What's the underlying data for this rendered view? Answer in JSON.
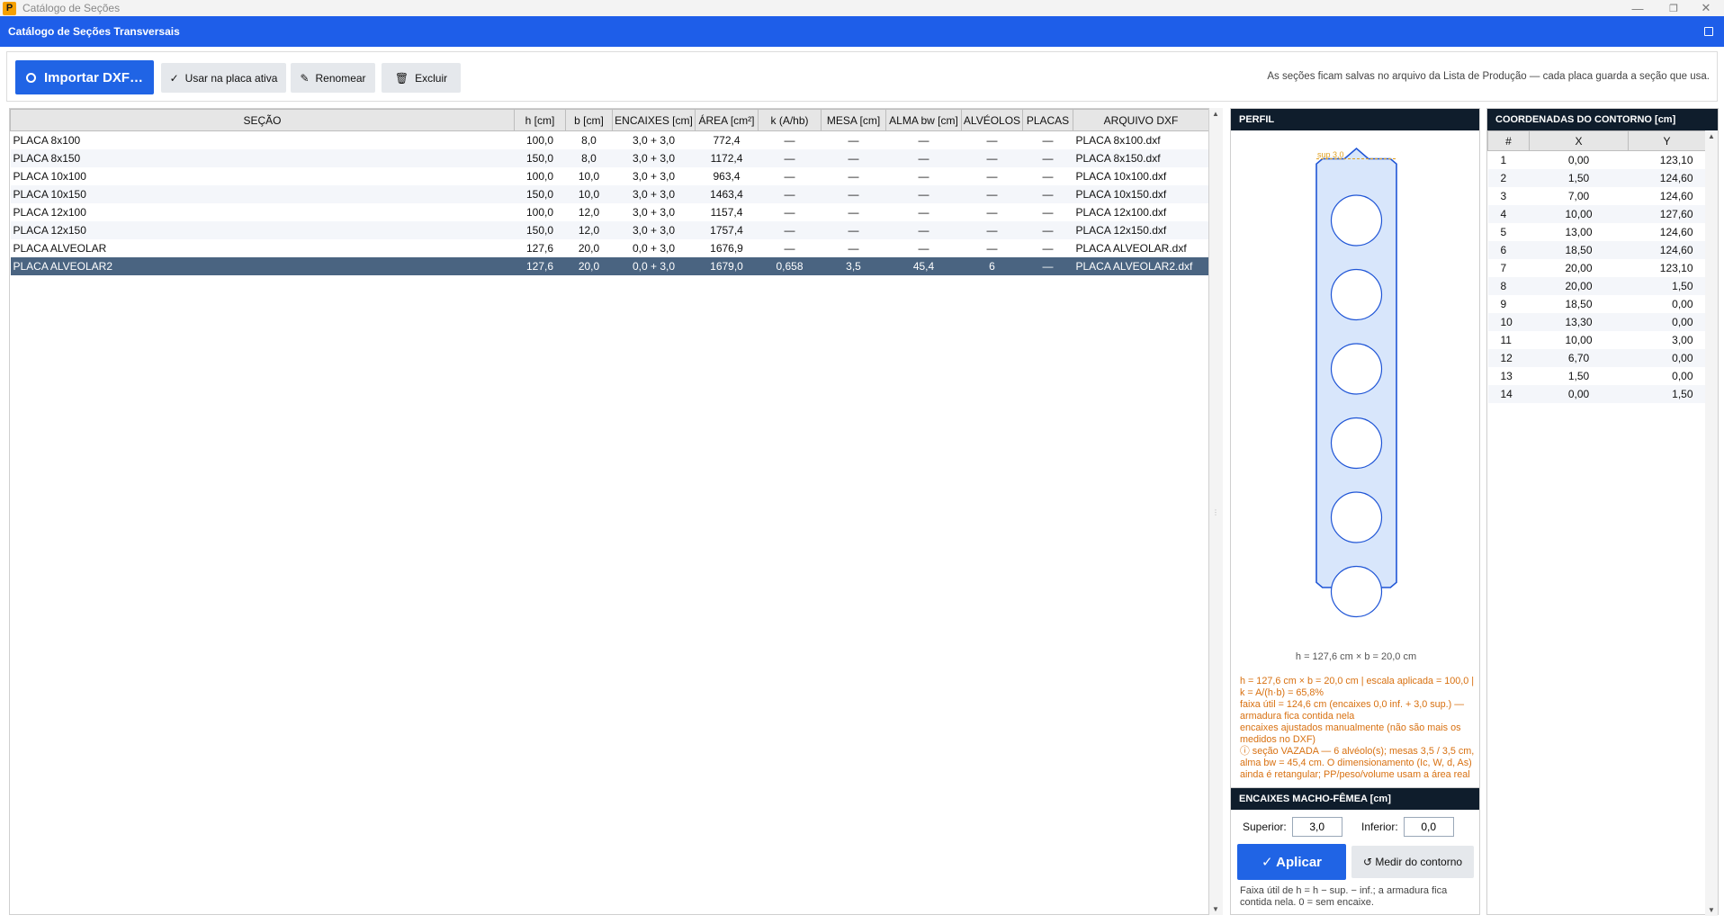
{
  "window": {
    "title": "Catálogo de Seções",
    "app_icon": "P"
  },
  "header": {
    "title": "Catálogo de Seções Transversais"
  },
  "toolbar": {
    "import_label": "Importar DXF…",
    "use_label": "Usar na placa ativa",
    "rename_label": "Renomear",
    "delete_label": "Excluir",
    "hint": "As seções ficam salvas no arquivo da Lista de Produção — cada placa guarda a seção que usa."
  },
  "table": {
    "columns": [
      "SEÇÃO",
      "h [cm]",
      "b [cm]",
      "ENCAIXES [cm]",
      "ÁREA [cm²]",
      "k (A/hb)",
      "MESA [cm]",
      "ALMA bw [cm]",
      "ALVÉOLOS",
      "PLACAS",
      "ARQUIVO DXF"
    ],
    "rows": [
      [
        "PLACA 8x100",
        "100,0",
        "8,0",
        "3,0 + 3,0",
        "772,4",
        "—",
        "—",
        "—",
        "—",
        "—",
        "PLACA 8x100.dxf"
      ],
      [
        "PLACA 8x150",
        "150,0",
        "8,0",
        "3,0 + 3,0",
        "1172,4",
        "—",
        "—",
        "—",
        "—",
        "—",
        "PLACA 8x150.dxf"
      ],
      [
        "PLACA 10x100",
        "100,0",
        "10,0",
        "3,0 + 3,0",
        "963,4",
        "—",
        "—",
        "—",
        "—",
        "—",
        "PLACA 10x100.dxf"
      ],
      [
        "PLACA 10x150",
        "150,0",
        "10,0",
        "3,0 + 3,0",
        "1463,4",
        "—",
        "—",
        "—",
        "—",
        "—",
        "PLACA 10x150.dxf"
      ],
      [
        "PLACA 12x100",
        "100,0",
        "12,0",
        "3,0 + 3,0",
        "1157,4",
        "—",
        "—",
        "—",
        "—",
        "—",
        "PLACA 12x100.dxf"
      ],
      [
        "PLACA 12x150",
        "150,0",
        "12,0",
        "3,0 + 3,0",
        "1757,4",
        "—",
        "—",
        "—",
        "—",
        "—",
        "PLACA 12x150.dxf"
      ],
      [
        "PLACA ALVEOLAR",
        "127,6",
        "20,0",
        "0,0 + 3,0",
        "1676,9",
        "—",
        "—",
        "—",
        "—",
        "—",
        "PLACA ALVEOLAR.dxf"
      ],
      [
        "PLACA ALVEOLAR2",
        "127,6",
        "20,0",
        "0,0 + 3,0",
        "1679,0",
        "0,658",
        "3,5",
        "45,4",
        "6",
        "—",
        "PLACA ALVEOLAR2.dxf"
      ]
    ],
    "selected_index": 7
  },
  "perfil": {
    "title": "PERFIL",
    "sup_label": "sup 3,0",
    "hole_count": 6,
    "dims": "h = 127,6 cm  ×  b = 20,0 cm",
    "notes": [
      "h = 127,6 cm  ×  b = 20,0 cm  |  escala aplicada = 100,0  |  k = A/(h·b) = 65,8%",
      "faixa útil = 124,6 cm (encaixes 0,0 inf. + 3,0 sup.) — armadura fica contida nela",
      "encaixes ajustados manualmente (não são mais os medidos no DXF)",
      "ⓘ seção VAZADA — 6 alvéolo(s); mesas 3,5 / 3,5 cm, alma bw = 45,4 cm. O dimensionamento (Ic, W, d, As) ainda é retangular; PP/peso/volume usam a área real"
    ],
    "colors": {
      "outline": "#1f55d6",
      "fill": "#d8e6fb",
      "label": "#e0a020"
    }
  },
  "encaixes": {
    "title": "ENCAIXES MACHO-FÊMEA  [cm]",
    "superior_label": "Superior:",
    "superior_value": "3,0",
    "inferior_label": "Inferior:",
    "inferior_value": "0,0",
    "apply_label": "✓ Aplicar",
    "measure_label": "↺ Medir do contorno",
    "footnote": "Faixa útil de h = h − sup. − inf.; a armadura fica contida nela. 0 = sem encaixe."
  },
  "coords": {
    "title": "COORDENADAS DO CONTORNO  [cm]",
    "columns": [
      "#",
      "X",
      "Y"
    ],
    "rows": [
      [
        "1",
        "0,00",
        "123,10"
      ],
      [
        "2",
        "1,50",
        "124,60"
      ],
      [
        "3",
        "7,00",
        "124,60"
      ],
      [
        "4",
        "10,00",
        "127,60"
      ],
      [
        "5",
        "13,00",
        "124,60"
      ],
      [
        "6",
        "18,50",
        "124,60"
      ],
      [
        "7",
        "20,00",
        "123,10"
      ],
      [
        "8",
        "20,00",
        "1,50"
      ],
      [
        "9",
        "18,50",
        "0,00"
      ],
      [
        "10",
        "13,30",
        "0,00"
      ],
      [
        "11",
        "10,00",
        "3,00"
      ],
      [
        "12",
        "6,70",
        "0,00"
      ],
      [
        "13",
        "1,50",
        "0,00"
      ],
      [
        "14",
        "0,00",
        "1,50"
      ]
    ]
  }
}
